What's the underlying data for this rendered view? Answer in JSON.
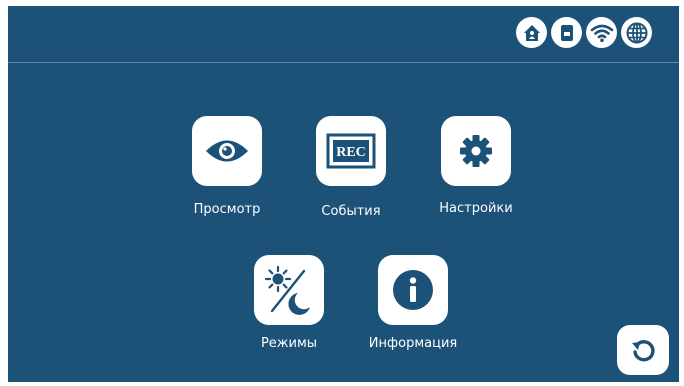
{
  "colors": {
    "background": "#1c5277",
    "tile": "#ffffff",
    "icon": "#1c5277",
    "label": "#ffffff"
  },
  "status_bar": {
    "icons": [
      "home-icon",
      "sd-card-icon",
      "wifi-icon",
      "globe-icon"
    ]
  },
  "menu": {
    "view": {
      "label": "Просмотр",
      "icon": "eye-icon"
    },
    "events": {
      "label": "События",
      "icon": "rec-icon",
      "icon_text": "REC"
    },
    "settings": {
      "label": "Настройки",
      "icon": "gear-icon"
    },
    "modes": {
      "label": "Режимы",
      "icon": "sun-moon-icon"
    },
    "info": {
      "label": "Информация",
      "icon": "info-icon"
    }
  },
  "back_button": {
    "icon": "back-arrow-icon"
  }
}
